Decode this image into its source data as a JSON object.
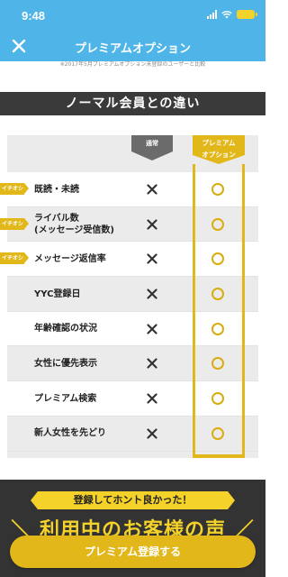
{
  "status_bar": {
    "time": "9:48"
  },
  "nav": {
    "title": "プレミアムオプション",
    "close_icon": "close-icon"
  },
  "footnote": "※2017年5月プレミアムオプション未登録のユーザーと比較",
  "section": {
    "title": "ノーマル会員との違い"
  },
  "comparison": {
    "columns": {
      "normal": "通常",
      "premium_line1": "プレミアム",
      "premium_line2": "オプション"
    },
    "rows": [
      {
        "tag": "イチオシ",
        "label_line1": "既読・未読",
        "label_line2": "",
        "normal": "✕",
        "premium": "○"
      },
      {
        "tag": "イチオシ",
        "label_line1": "ライバル数",
        "label_line2": "(メッセージ受信数)",
        "normal": "✕",
        "premium": "○"
      },
      {
        "tag": "イチオシ",
        "label_line1": "メッセージ返信率",
        "label_line2": "",
        "normal": "✕",
        "premium": "○"
      },
      {
        "tag": "",
        "label_line1": "YYC登録日",
        "label_line2": "",
        "normal": "✕",
        "premium": "○"
      },
      {
        "tag": "",
        "label_line1": "年齢確認の状況",
        "label_line2": "",
        "normal": "✕",
        "premium": "○"
      },
      {
        "tag": "",
        "label_line1": "女性に優先表示",
        "label_line2": "",
        "normal": "✕",
        "premium": "○"
      },
      {
        "tag": "",
        "label_line1": "プレミアム検索",
        "label_line2": "",
        "normal": "✕",
        "premium": "○"
      },
      {
        "tag": "",
        "label_line1": "新人女性を先どり",
        "label_line2": "",
        "normal": "✕",
        "premium": "○"
      }
    ]
  },
  "testimonial": {
    "ribbon": "登録してホント良かった！",
    "heading": "＼ 利用中のお客様の声 ／"
  },
  "cta": {
    "label": "プレミアム登録する"
  },
  "colors": {
    "header": "#4fb4e8",
    "accent": "#e2b71a",
    "dark": "#3a3a3a"
  }
}
